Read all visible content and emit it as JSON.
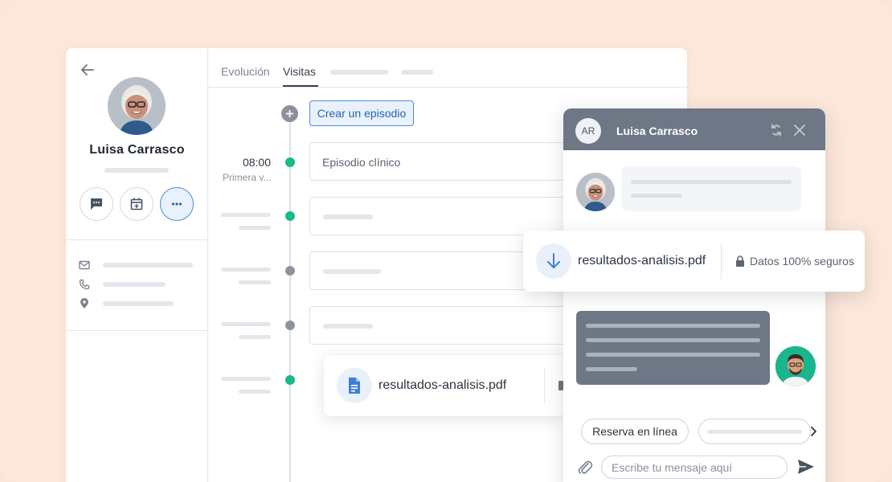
{
  "patient": {
    "name": "Luisa Carrasco"
  },
  "tabs": [
    {
      "label": "Evolución"
    },
    {
      "label": "Visitas"
    }
  ],
  "timeline": {
    "create_label": "Crear un episodio",
    "first_entry": {
      "time": "08:00",
      "subtitle": "Primera v...",
      "card_text": "Episodio clínico"
    }
  },
  "file_card": {
    "filename": "resultados-analisis.pdf"
  },
  "chat": {
    "initials": "AR",
    "title": "Luisa Carrasco",
    "chip_label": "Reserva en línea",
    "input_placeholder": "Escribe tu mensaje aquí"
  },
  "download_card": {
    "filename": "resultados-analisis.pdf",
    "secure_label": "Datos 100% seguros"
  },
  "icons": {
    "back": "arrow-left-icon",
    "message": "message-icon",
    "calendar": "calendar-add-icon",
    "more": "more-icon",
    "mail": "mail-icon",
    "phone": "phone-icon",
    "location": "location-icon",
    "plus": "plus-icon",
    "document": "document-icon",
    "download": "download-icon",
    "lock": "lock-icon",
    "minimize": "minimize-icon",
    "close": "close-icon",
    "attach": "paperclip-icon",
    "send": "send-icon",
    "chevron": "chevron-right-icon"
  },
  "colors": {
    "background": "#fae6d8",
    "accent_blue": "#4b8ad8",
    "status_green": "#18b98a",
    "status_grey": "#8d949e",
    "chat_header": "#6d7785"
  }
}
